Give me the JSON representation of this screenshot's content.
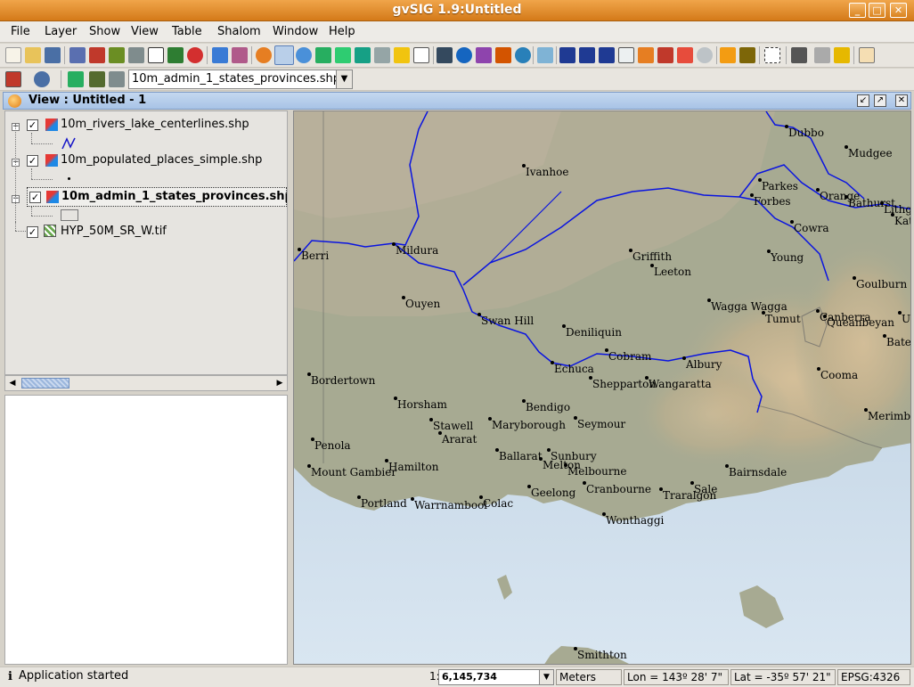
{
  "window": {
    "title": "gvSIG 1.9:Untitled"
  },
  "menubar": [
    "File",
    "Layer",
    "Show",
    "View",
    "Table",
    "Shalom",
    "Window",
    "Help"
  ],
  "toolbar": {
    "active_layer": "10m_admin_1_states_provinces.shp"
  },
  "view": {
    "title": "View : Untitled - 1"
  },
  "toc": {
    "layers": [
      {
        "name": "10m_rivers_lake_centerlines.shp",
        "checked": true,
        "bold": false
      },
      {
        "name": "10m_populated_places_simple.shp",
        "checked": true,
        "bold": false
      },
      {
        "name": "10m_admin_1_states_provinces.shp",
        "checked": true,
        "bold": true
      },
      {
        "name": "HYP_50M_SR_W.tif",
        "checked": true,
        "bold": false
      }
    ]
  },
  "map": {
    "cities": [
      "Dubbo",
      "Mudgee",
      "Ivanhoe",
      "Parkes",
      "Orange",
      "Forbes",
      "Bathurst",
      "Lithg",
      "Kat",
      "Cowra",
      "Mildura",
      "Berri",
      "Griffith",
      "Young",
      "Leeton",
      "Goulburn",
      "Ouyen",
      "Wagga Wagga",
      "Tumut",
      "Canberra",
      "Queanbeyan",
      "Swan Hill",
      "Deniliquin",
      "Bate",
      "Cobram",
      "Albury",
      "Echuca",
      "Cooma",
      "Bordertown",
      "Shepparton",
      "Wangaratta",
      "Horsham",
      "Bendigo",
      "Stawell",
      "Maryborough",
      "Seymour",
      "Merimb",
      "Ararat",
      "Penola",
      "Ballarat",
      "Sunbury",
      "Melton",
      "Hamilton",
      "Melbourne",
      "Mount Gambier",
      "Bairnsdale",
      "Geelong",
      "Cranbourne",
      "Sale",
      "Traralgon",
      "Portland",
      "Warrnambool",
      "Colac",
      "Wonthaggi",
      "Smithton",
      "U"
    ]
  },
  "status": {
    "message": "Application started",
    "scale_prefix": "1:",
    "scale": "6,145,734",
    "units": "Meters",
    "lon": "Lon = 143º 28' 7\"",
    "lat": "Lat = -35º 57' 21\"",
    "epsg": "EPSG:4326"
  }
}
